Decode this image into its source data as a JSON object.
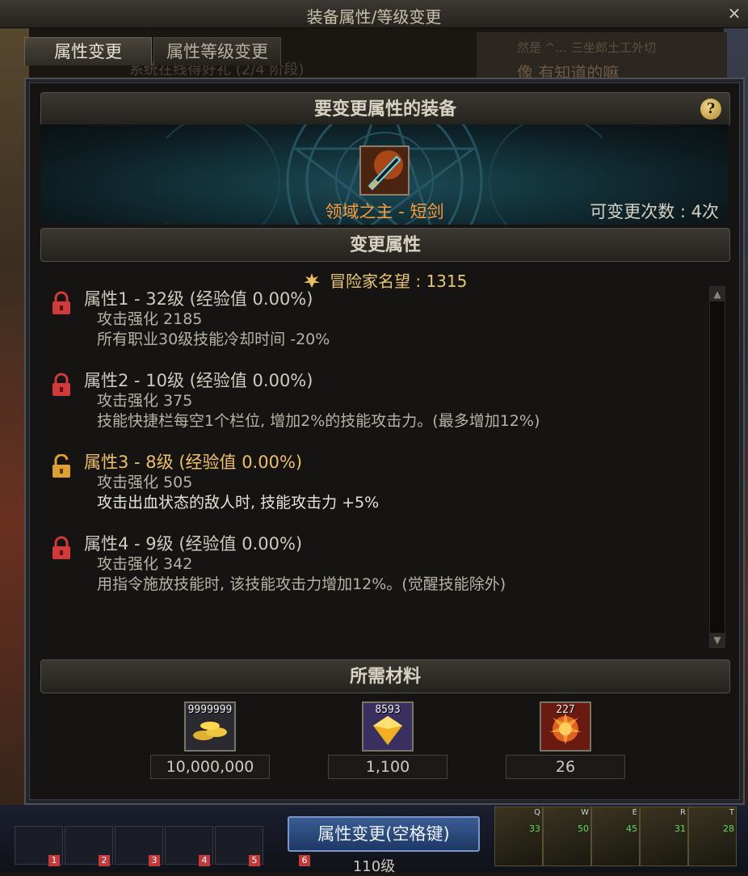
{
  "window": {
    "title": "装备属性/等级变更",
    "close_glyph": "×"
  },
  "tabs": [
    {
      "label": "属性变更",
      "active": true
    },
    {
      "label": "属性等级变更",
      "active": false
    }
  ],
  "background": {
    "top_right_line1": "然是 ^… 三坐郎土工外切",
    "top_right_line2": "像 有知道的嘛",
    "under_tab_text": "系统在线得好礼 (2/4 阶段)"
  },
  "equipment_section": {
    "header": "要变更属性的装备",
    "help_glyph": "?",
    "item_name": "领域之主 - 短剑",
    "change_count": "可变更次数 : 4次"
  },
  "attributes_section": {
    "header": "变更属性",
    "fame": "冒险家名望 : 1315",
    "attributes": [
      {
        "title": "属性1 - 32级 (经验值 0.00%)",
        "locked": true,
        "lines": [
          "攻击强化 2185",
          "所有职业30级技能冷却时间 -20%"
        ]
      },
      {
        "title": "属性2 - 10级 (经验值 0.00%)",
        "locked": true,
        "lines": [
          "攻击强化 375",
          "技能快捷栏每空1个栏位, 增加2%的技能攻击力。(最多增加12%)"
        ]
      },
      {
        "title": "属性3 - 8级 (经验值 0.00%)",
        "locked": false,
        "lines": [
          "攻击强化 505",
          "攻击出血状态的敌人时, 技能攻击力 +5%"
        ]
      },
      {
        "title": "属性4 - 9级 (经验值 0.00%)",
        "locked": true,
        "lines": [
          "攻击强化 342",
          "用指令施放技能时, 该技能攻击力增加12%。(觉醒技能除外)"
        ]
      }
    ]
  },
  "materials_section": {
    "header": "所需材料",
    "materials": [
      {
        "icon": "gold-coins-icon",
        "stock": "9999999",
        "required": "10,000,000"
      },
      {
        "icon": "gold-crystal-icon",
        "stock": "8593",
        "required": "1,100"
      },
      {
        "icon": "explosion-orb-icon",
        "stock": "227",
        "required": "26"
      }
    ]
  },
  "bottom": {
    "confirm_button": "属性变更(空格键)",
    "level": "110级",
    "slot_numbers": [
      "1",
      "2",
      "3",
      "4",
      "5",
      "6"
    ],
    "right_skill_keys": [
      "Q",
      "W",
      "E",
      "R",
      "T"
    ],
    "right_skill_levels": [
      "33",
      "50",
      "45",
      "31",
      "28"
    ]
  },
  "colors": {
    "item_name": "#ff9d3a",
    "fame": "#e8c670",
    "unlocked_title": "#f0c060",
    "lock_red": "#d03a3a",
    "lock_gold": "#e0a030"
  }
}
